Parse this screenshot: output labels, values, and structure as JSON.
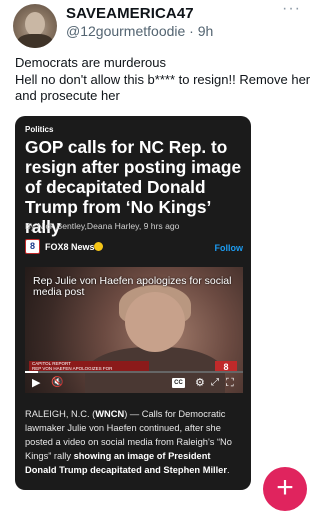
{
  "post": {
    "display_name": "SAVEAMERICA47",
    "handle_time": "@12gourmetfoodie · 9h",
    "more": "···",
    "lines": [
      "Democrats are murderous",
      "Hell no don't allow this b**** to resign!! Remove her",
      "and prosecute her"
    ]
  },
  "card": {
    "tag": "Politics",
    "headline": "GOP calls for NC Rep. to resign after posting image of decapitated Donald Trump from ‘No Kings’ rally",
    "byline": "By Nick Bentley,Deana Harley,  9 hrs ago",
    "source_logo": "8",
    "source_name": "FOX8 News",
    "follow": "Follow",
    "video": {
      "caption": "Rep Julie von Haefen apologizes for social media post",
      "lower_third_1": "CAPITOL REPORT",
      "lower_third_2": "REP VON HAEFEN APOLOGIZES FOR",
      "station_logo": "8",
      "progress": 0.06
    },
    "controls": {
      "play": "▶",
      "mute": "🔇",
      "cc": "CC",
      "settings": "⚙",
      "expand": "⤢",
      "fullscreen": "⛶"
    },
    "article": {
      "line1_pre": "RALEIGH, N.C. (",
      "line1_bold": "WNCN",
      "line1_post": ") — Calls for Democratic",
      "line2": "lawmaker Julie von Haefen continued, after she",
      "line3": "posted a video on social media from Raleigh's “No",
      "line4_pre": "Kings” rally ",
      "line4_bold": "showing an image of President",
      "line5_bold": "Donald Trump decapitated and Stephen Miller",
      "line5_post": "."
    }
  },
  "fab": {
    "label": "+"
  },
  "colors": {
    "accent": "#1d9bf0",
    "fab": "#e0245e",
    "card_bg": "#1b1b1b"
  }
}
